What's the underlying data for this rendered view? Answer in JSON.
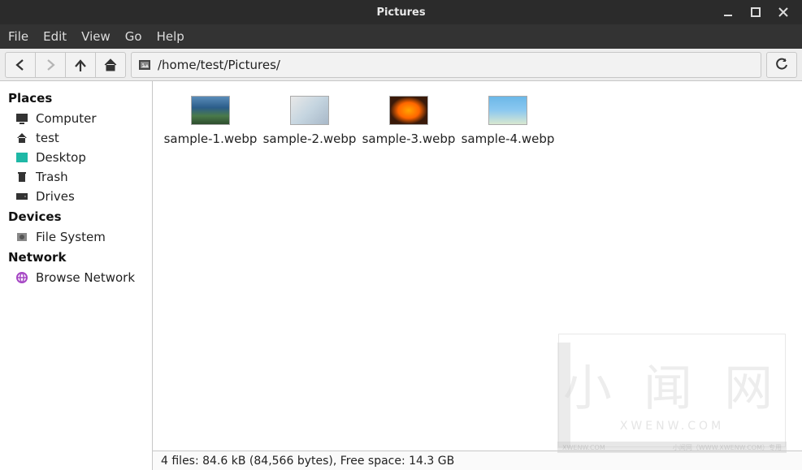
{
  "window": {
    "title": "Pictures"
  },
  "menubar": {
    "items": [
      "File",
      "Edit",
      "View",
      "Go",
      "Help"
    ]
  },
  "toolbar": {
    "path": "/home/test/Pictures/"
  },
  "sidebar": {
    "sections": [
      {
        "title": "Places",
        "items": [
          {
            "icon": "computer-icon",
            "label": "Computer"
          },
          {
            "icon": "home-icon",
            "label": "test"
          },
          {
            "icon": "desktop-icon",
            "label": "Desktop"
          },
          {
            "icon": "trash-icon",
            "label": "Trash"
          },
          {
            "icon": "drives-icon",
            "label": "Drives"
          }
        ]
      },
      {
        "title": "Devices",
        "items": [
          {
            "icon": "filesystem-icon",
            "label": "File System"
          }
        ]
      },
      {
        "title": "Network",
        "items": [
          {
            "icon": "network-icon",
            "label": "Browse Network"
          }
        ]
      }
    ]
  },
  "files": [
    {
      "name": "sample-1.webp",
      "thumb": "t1"
    },
    {
      "name": "sample-2.webp",
      "thumb": "t2"
    },
    {
      "name": "sample-3.webp",
      "thumb": "t3"
    },
    {
      "name": "sample-4.webp",
      "thumb": "t4"
    }
  ],
  "statusbar": {
    "text": "4 files: 84.6 kB (84,566 bytes), Free space: 14.3 GB"
  },
  "watermark": {
    "big": "小 闻 网",
    "small": "XWENW.COM",
    "bl": "XWENW.COM",
    "br": "小闻网（WWW.XWENW.COM）专用"
  }
}
